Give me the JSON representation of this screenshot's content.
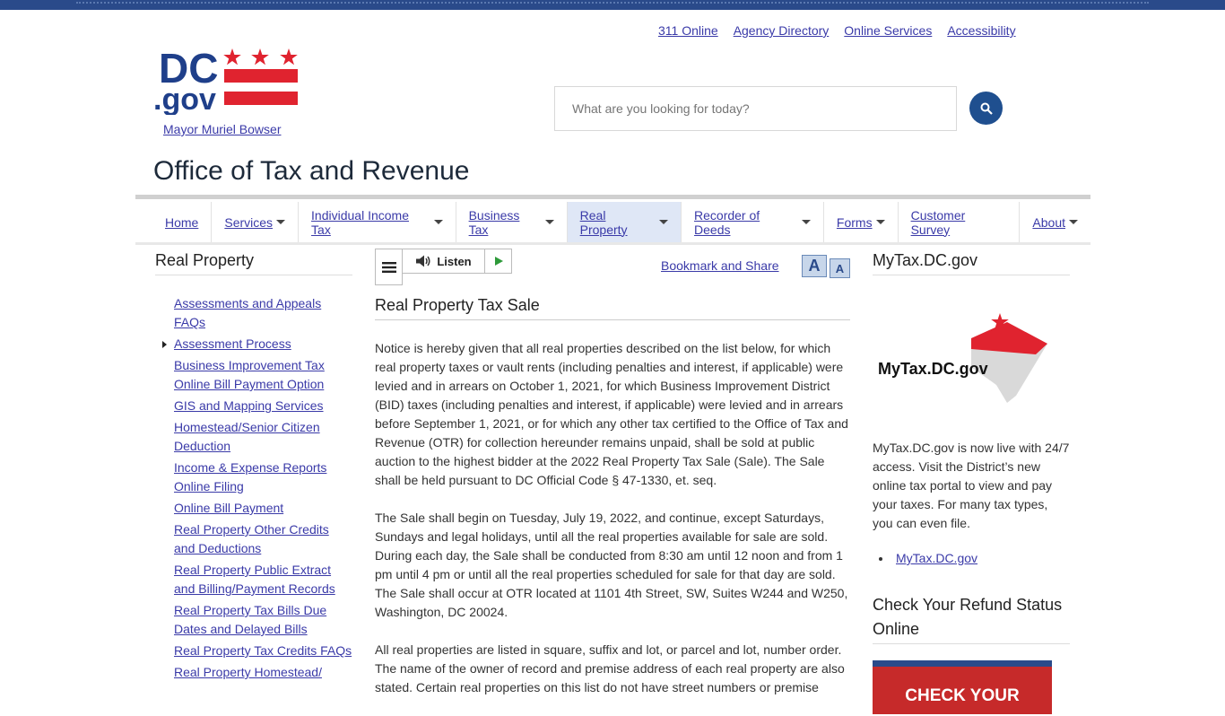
{
  "utility_links": [
    "311 Online",
    "Agency Directory",
    "Online Services",
    "Accessibility"
  ],
  "logo": {
    "text_dc": "DC",
    "text_gov": ".gov"
  },
  "mayor_link": "Mayor Muriel Bowser",
  "search": {
    "placeholder": "What are you looking for today?"
  },
  "site_title": "Office of Tax and Revenue",
  "nav": [
    {
      "label": "Home",
      "caret": false
    },
    {
      "label": "Services",
      "caret": true
    },
    {
      "label": "Individual Income Tax",
      "caret": true
    },
    {
      "label": "Business Tax",
      "caret": true
    },
    {
      "label": "Real Property",
      "caret": true,
      "active": true
    },
    {
      "label": "Recorder of Deeds",
      "caret": true
    },
    {
      "label": "Forms",
      "caret": true
    },
    {
      "label": "Customer Survey",
      "caret": false
    },
    {
      "label": "About",
      "caret": true
    }
  ],
  "sidebar": {
    "title": "Real Property",
    "items": [
      "Assessments and Appeals FAQs",
      "Assessment Process",
      "Business Improvement Tax Online Bill Payment Option",
      "GIS and Mapping Services",
      "Homestead/Senior Citizen Deduction",
      "Income & Expense Reports Online Filing",
      "Online Bill Payment",
      "Real Property Other Credits and Deductions",
      "Real Property Public Extract and Billing/Payment Records",
      "Real Property Tax Bills Due Dates and Delayed Bills",
      "Real Property Tax Credits FAQs",
      "Real Property Homestead/"
    ]
  },
  "toolbar": {
    "listen_label": "Listen",
    "bookmark_label": "Bookmark and Share",
    "font_up": "A",
    "font_down": "A"
  },
  "main": {
    "heading": "Real Property Tax Sale",
    "paragraphs": [
      "Notice is hereby given that all real properties described on the list below, for which real property taxes or vault rents (including penalties and interest, if applicable) were levied and in arrears on October 1, 2021, for which Business Improvement District (BID) taxes (including penalties and interest, if applicable) were levied and in arrears before September 1, 2021, or for which any other tax certified to the Office of Tax and Revenue (OTR) for collection hereunder remains unpaid, shall be sold at public auction to the highest bidder at the 2022 Real Property Tax Sale (Sale). The Sale shall be held pursuant to DC Official Code § 47-1330, et. seq.",
      "The Sale shall begin on Tuesday, July 19, 2022, and continue, except Saturdays, Sundays and legal holidays, until all the real properties available for sale are sold. During each day, the Sale shall be conducted from 8:30 am until 12 noon and from 1 pm until 4 pm or until all the real properties scheduled for sale for that day are sold. The Sale shall occur at OTR located at 1101 4th Street, SW, Suites W244 and W250, Washington, DC 20024.",
      "All real properties are listed in square, suffix and lot, or parcel and lot, number order. The name of the owner of record and premise address of each real property are also stated. Certain real properties on this list do not have street numbers or premise"
    ]
  },
  "right": {
    "title": "MyTax.DC.gov",
    "logo_text": "MyTax.DC.gov",
    "description": "MyTax.DC.gov is now live with 24/7 access. Visit the District’s new online tax portal to view and pay your taxes. For many tax types, you can even file.",
    "link": "MyTax.DC.gov",
    "refund_title": "Check Your Refund Status Online",
    "banner_text": "CHECK YOUR"
  }
}
